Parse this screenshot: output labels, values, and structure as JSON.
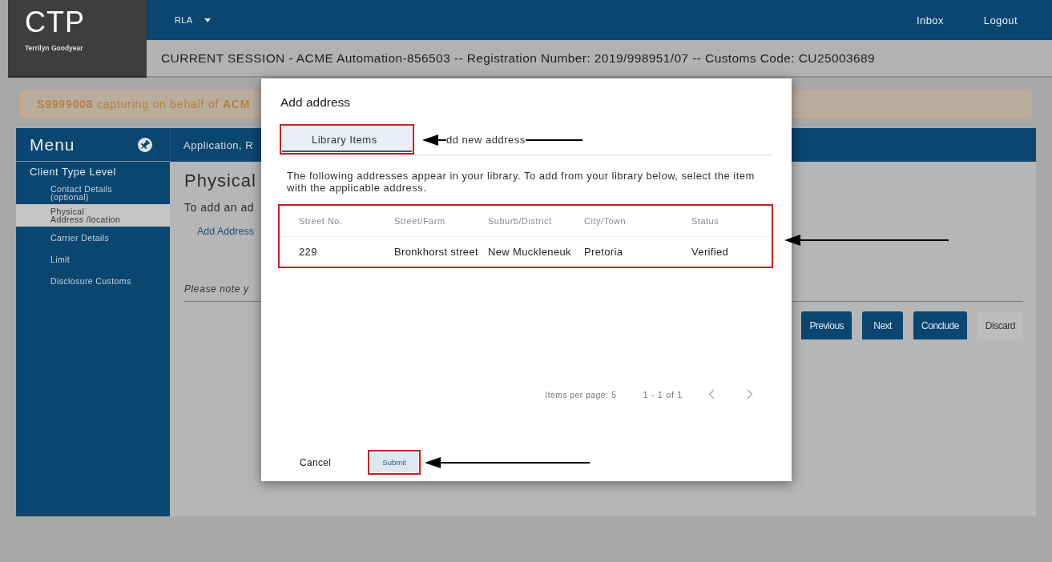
{
  "header": {
    "logo": "CTP",
    "user": "Terrilyn Goodyear",
    "profile_menu": "RLA",
    "links": [
      "Inbox",
      "Logout"
    ],
    "session": "CURRENT SESSION - ACME Automation-856503 -- Registration Number: 2019/998951/07 -- Customs Code: CU25003689"
  },
  "alert": {
    "text": "**S9999008** capturing on behalf of **ACM**"
  },
  "sidebar": {
    "title": "Menu",
    "items": [
      {
        "label": "Client Type Level",
        "selected": false,
        "children": [
          {
            "label": "Contact Details\n(optional)",
            "selected": false
          },
          {
            "label": "Physical\nAddress /location",
            "selected": true
          },
          {
            "label": "Carrier Details",
            "selected": false
          },
          {
            "label": "Limit",
            "selected": false
          },
          {
            "label": "Disclosure Customs",
            "selected": false
          }
        ]
      }
    ]
  },
  "content": {
    "breadcrumb": "Application, R",
    "heading": "Physical",
    "intro": "To add an ad",
    "link": "Add Address",
    "note": "Please note y",
    "buttons": [
      {
        "label": "Previous",
        "kind": "primary"
      },
      {
        "label": "Next",
        "kind": "primary"
      },
      {
        "label": "Conclude",
        "kind": "primary"
      },
      {
        "label": "Discard",
        "kind": "secondary"
      }
    ]
  },
  "modal": {
    "title": "Add address",
    "tabs": [
      {
        "label": "Library Items",
        "selected": true,
        "highlighted": true
      },
      {
        "label": "dd new address",
        "selected": false,
        "highlighted": false
      }
    ],
    "description": "The following addresses appear in your library. To add from your library below, select the item with the applicable address.",
    "table": {
      "highlighted": true,
      "columns": [
        "Street No.",
        "Street/Farm",
        "Suburb/District",
        "City/Town",
        "Status"
      ],
      "rows": [
        [
          "229",
          "Bronkhorst street",
          "New Muckleneuk",
          "Pretoria",
          "Verified"
        ]
      ]
    },
    "pagination": {
      "label": "Items per page:",
      "page_size": "5",
      "range": "1 - 1 of 1",
      "previous_disabled": true,
      "next_disabled": true
    },
    "buttons": [
      {
        "label": "Cancel",
        "kind": "text",
        "highlighted": false
      },
      {
        "label": "Submit",
        "kind": "primary",
        "highlighted": true
      }
    ]
  }
}
